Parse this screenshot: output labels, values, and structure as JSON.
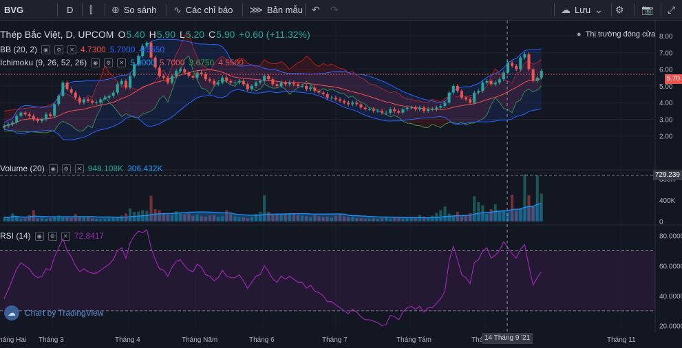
{
  "toolbar": {
    "symbol": "BVG",
    "interval": "D",
    "compare": "So sánh",
    "indicators": "Các chỉ báo",
    "template": "Bản mẫu",
    "save": "Lưu"
  },
  "header": {
    "title": "Thép Bắc Việt, D, UPCOM",
    "o_label": "O",
    "o": "5.40",
    "h_label": "H",
    "h": "5.90",
    "l_label": "L",
    "l": "5.20",
    "c_label": "C",
    "c": "5.90",
    "change": "+0.60 (+11.32%)",
    "market_status": "Thị trường đóng cửa"
  },
  "legends": {
    "bb": {
      "name": "BB (20, 2)",
      "v1": "4.7300",
      "v2": "5.7000",
      "v3": "4.5550"
    },
    "ichimoku": {
      "name": "Ichimoku (9, 26, 52, 26)",
      "v1": "5.0000",
      "v2": "5.7000",
      "v3": "3.6750",
      "v4": "4.5500"
    },
    "volume": {
      "name": "Volume (20)",
      "v1": "948.108K",
      "v2": "306.432K"
    },
    "rsi": {
      "name": "RSI (14)",
      "v1": "72.8417"
    }
  },
  "price_tag": "5.70",
  "volume_tag": "729.239",
  "crosshair_date": "14 Tháng 9 '21",
  "watermark": "Chart by TradingView",
  "colors": {
    "up": "#26a69a",
    "down": "#ef5350",
    "bg": "#131722",
    "bb": "#2962ff",
    "kijun": "#b71c1c",
    "rsi": "#9c27b0",
    "volume_ma": "#1e88e5"
  },
  "chart_data": {
    "type": "candlestick",
    "x_tick_labels": [
      "Tháng Hai",
      "Tháng 3",
      "Tháng 4",
      "Tháng Năm",
      "Tháng 6",
      "Tháng 7",
      "Tháng Tám",
      "Tháng 9",
      "Tháng 11"
    ],
    "price_axis": {
      "ticks": [
        "8.00",
        "7.00",
        "6.00",
        "5.00",
        "4.00",
        "3.00",
        "2.00"
      ],
      "range": [
        1.0,
        8.5
      ]
    },
    "volume_axis": {
      "ticks": [
        "800K",
        "400K",
        "0"
      ],
      "range": [
        0,
        900000
      ]
    },
    "rsi_axis": {
      "ticks": [
        "80.0000",
        "60.0000",
        "40.0000",
        "20.0000"
      ],
      "range": [
        18,
        84
      ],
      "bands": [
        70,
        30
      ]
    },
    "close": [
      2.6,
      2.7,
      2.8,
      3.2,
      3.4,
      3.3,
      3.2,
      3.0,
      2.9,
      3.0,
      3.3,
      3.2,
      3.9,
      4.4,
      5.2,
      4.8,
      4.6,
      4.3,
      4.0,
      4.2,
      4.1,
      4.0,
      4.0,
      4.2,
      4.3,
      4.4,
      4.6,
      5.1,
      5.3,
      4.9,
      5.6,
      6.3,
      6.8,
      7.4,
      7.6,
      6.7,
      6.1,
      5.6,
      5.5,
      5.2,
      5.6,
      5.9,
      6.0,
      5.8,
      5.6,
      5.5,
      5.8,
      5.7,
      5.4,
      5.3,
      5.1,
      5.2,
      5.5,
      5.3,
      5.2,
      5.2,
      5.3,
      5.1,
      4.8,
      5.0,
      5.2,
      5.3,
      5.6,
      5.4,
      5.1,
      5.0,
      5.2,
      5.1,
      5.2,
      5.1,
      5.0,
      5.0,
      4.8,
      4.9,
      4.7,
      4.6,
      4.5,
      4.3,
      4.3,
      4.2,
      4.1,
      4.0,
      3.9,
      4.0,
      3.9,
      3.7,
      3.6,
      3.6,
      3.5,
      3.5,
      3.4,
      3.4,
      3.6,
      3.5,
      3.4,
      3.6,
      3.7,
      3.7,
      3.6,
      3.7,
      3.5,
      3.6,
      3.6,
      3.7,
      3.8,
      4.0,
      4.6,
      5.0,
      4.7,
      4.3,
      4.2,
      4.0,
      4.6,
      4.7,
      5.2,
      5.3,
      5.1,
      5.2,
      5.4,
      5.8,
      6.4,
      6.2,
      6.0,
      6.7,
      6.9,
      6.0,
      5.3,
      5.5,
      5.9
    ],
    "volume_k": [
      80,
      60,
      150,
      90,
      40,
      55,
      120,
      210,
      60,
      70,
      50,
      60,
      80,
      110,
      90,
      85,
      70,
      140,
      85,
      80,
      95,
      60,
      50,
      40,
      45,
      60,
      65,
      70,
      110,
      150,
      240,
      180,
      185,
      210,
      200,
      480,
      230,
      210,
      160,
      130,
      120,
      190,
      150,
      140,
      150,
      100,
      130,
      100,
      90,
      110,
      120,
      85,
      100,
      210,
      140,
      95,
      80,
      80,
      60,
      90,
      140,
      180,
      490,
      180,
      120,
      150,
      140,
      150,
      140,
      140,
      120,
      110,
      100,
      80,
      120,
      100,
      80,
      90,
      70,
      110,
      140,
      90,
      80,
      90,
      60,
      60,
      50,
      55,
      60,
      50,
      60,
      80,
      50,
      80,
      70,
      55,
      60,
      70,
      80,
      120,
      90,
      70,
      110,
      160,
      210,
      280,
      150,
      120,
      180,
      100,
      110,
      160,
      470,
      360,
      300,
      140,
      230,
      320,
      190,
      210,
      160,
      500,
      200,
      250,
      880,
      490,
      280,
      860,
      520,
      410,
      420
    ],
    "rsi": [
      38,
      44,
      51,
      58,
      62,
      60,
      58,
      54,
      52,
      53,
      58,
      57,
      66,
      72,
      78,
      70,
      66,
      60,
      56,
      58,
      56,
      55,
      55,
      57,
      59,
      61,
      64,
      70,
      72,
      65,
      75,
      80,
      83,
      82,
      84,
      72,
      64,
      58,
      57,
      53,
      59,
      63,
      64,
      60,
      57,
      56,
      61,
      59,
      54,
      53,
      50,
      52,
      57,
      53,
      52,
      52,
      54,
      50,
      45,
      49,
      53,
      54,
      60,
      56,
      51,
      49,
      53,
      51,
      53,
      51,
      49,
      49,
      45,
      47,
      43,
      42,
      40,
      36,
      36,
      34,
      32,
      30,
      28,
      31,
      29,
      26,
      24,
      24,
      23,
      22,
      20,
      21,
      27,
      26,
      24,
      29,
      32,
      33,
      31,
      33,
      29,
      32,
      32,
      35,
      38,
      43,
      63,
      73,
      64,
      54,
      52,
      48,
      62,
      64,
      70,
      72,
      65,
      67,
      70,
      76,
      72,
      68,
      65,
      71,
      74,
      60,
      47,
      52,
      56
    ]
  }
}
